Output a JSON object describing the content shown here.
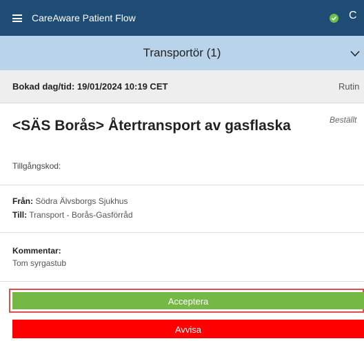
{
  "app": {
    "title": "CareAware Patient Flow",
    "status_icon": "check-circle-icon",
    "refresh_icon": "refresh-icon",
    "menu_icon": "hamburger-menu-icon"
  },
  "section": {
    "title": "Transportör (1)",
    "toggle_icon": "chevron-down-icon"
  },
  "task": {
    "booked_label": "Bokad dag/tid: 19/01/2024 10:19 CET",
    "priority": "Rutin",
    "title": "<SÄS Borås> Återtransport av gasflaska",
    "status": "Beställt",
    "access_code_label": "Tillgångskod:",
    "from_label": "Från:",
    "from_value": "Södra Älvsborgs Sjukhus",
    "to_label": "Till:",
    "to_value": "Transport - Borås-Gasförråd",
    "comment_label": "Kommentar:",
    "comment_value": "Tom syrgastub"
  },
  "actions": {
    "accept_label": "Acceptera",
    "reject_label": "Avvisa"
  },
  "colors": {
    "topbar": "#1f4c75",
    "section_header": "#b8d3ea",
    "accept": "#76b846",
    "reject": "#ff0000",
    "highlight": "#e64b4b",
    "status_ok": "#6cc04a"
  }
}
